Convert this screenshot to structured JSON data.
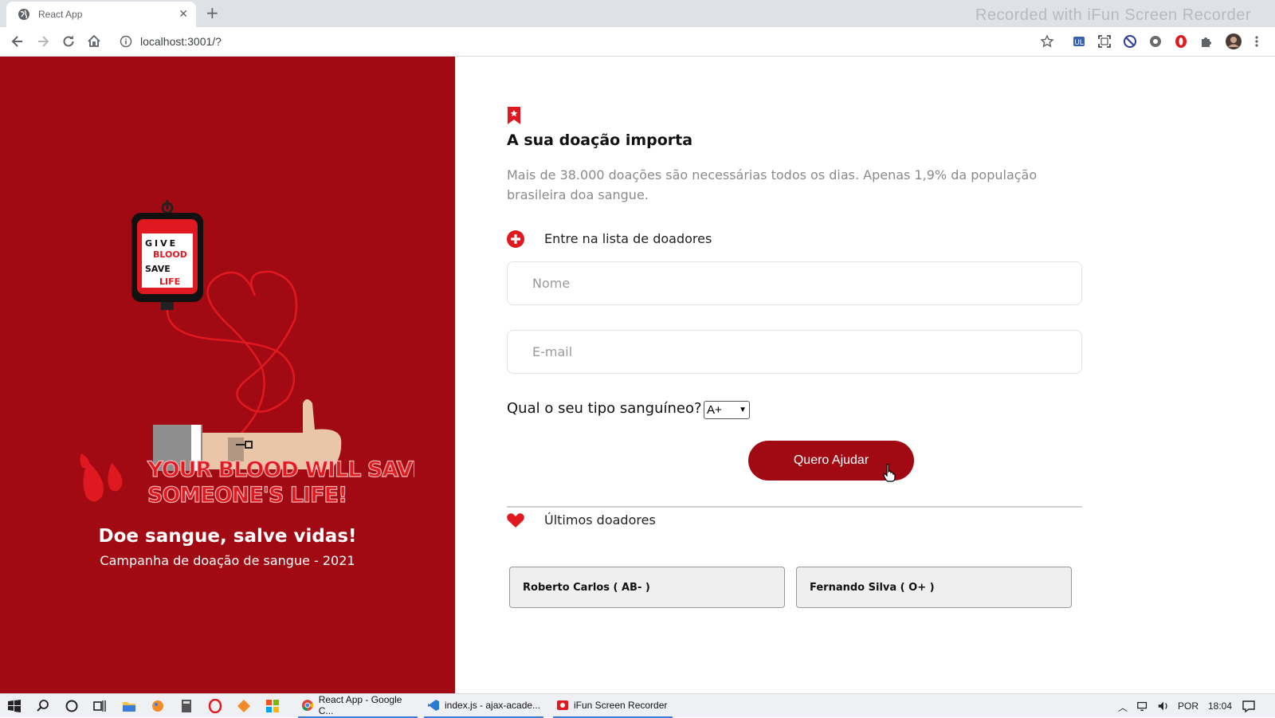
{
  "browser": {
    "tab_title": "React App",
    "url": "localhost:3001/?",
    "watermark": "Recorded with iFun Screen Recorder"
  },
  "hero": {
    "bag_text": [
      "GIVE",
      "BLOOD",
      "SAVE",
      "LIFE"
    ],
    "slogan_line1": "YOUR BLOOD WILL SAVE",
    "slogan_line2": "SOMEONE'S LIFE!",
    "title": "Doe sangue, salve vidas!",
    "subtitle": "Campanha de doação de sangue - 2021"
  },
  "main": {
    "headline": "A sua doação importa",
    "description": "Mais de 38.000 doações são necessárias todos os dias. Apenas 1,9% da população brasileira doa sangue.",
    "signup_label": "Entre na lista de doadores",
    "name_placeholder": "Nome",
    "email_placeholder": "E-mail",
    "blood_type_question": "Qual o seu tipo sanguíneo?",
    "blood_type_selected": "A+",
    "submit_label": "Quero Ajudar",
    "donors_label": "Últimos doadores",
    "donors": [
      {
        "label": "Roberto Carlos ( AB- )"
      },
      {
        "label": "Fernando Silva ( O+ )"
      }
    ]
  },
  "colors": {
    "brand": "#a10a12",
    "accent_red": "#e0181f"
  },
  "taskbar": {
    "apps": [
      {
        "label": "React App - Google C..."
      },
      {
        "label": "index.js - ajax-acade..."
      },
      {
        "label": "iFun Screen Recorder"
      }
    ],
    "language": "POR",
    "time": "18:04"
  }
}
